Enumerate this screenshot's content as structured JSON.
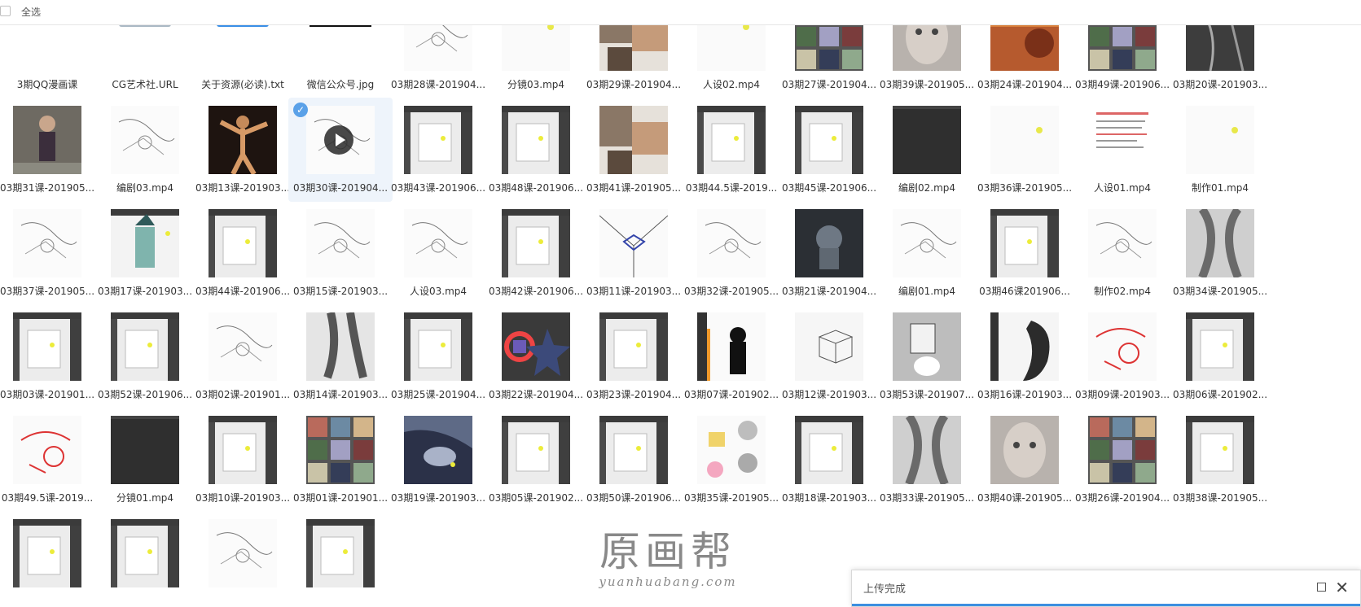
{
  "header": {
    "select_all": "全选"
  },
  "upload_panel": {
    "status": "上传完成"
  },
  "watermark": {
    "cn": "原画帮",
    "en": "yuanhuabang.com"
  },
  "colors": {
    "accent": "#3d8fe0",
    "selected_bg": "#eef4fb"
  },
  "files": [
    {
      "name": "3期QQ漫画课",
      "thumb": "folder-icon",
      "row": 0,
      "col": 0
    },
    {
      "name": "CG艺术社.URL",
      "thumb": "url-icon",
      "row": 0,
      "col": 1
    },
    {
      "name": "关于资源(必读).txt",
      "thumb": "txt-icon",
      "row": 0,
      "col": 2
    },
    {
      "name": "微信公众号.jpg",
      "thumb": "qr",
      "row": 0,
      "col": 3
    },
    {
      "name": "03期28课-201904...",
      "thumb": "sketch",
      "row": 0,
      "col": 4
    },
    {
      "name": "分镜03.mp4",
      "thumb": "white",
      "row": 0,
      "col": 5
    },
    {
      "name": "03期29课-201904...",
      "thumb": "photo",
      "row": 0,
      "col": 6
    },
    {
      "name": "人设02.mp4",
      "thumb": "white",
      "row": 0,
      "col": 7
    },
    {
      "name": "03期27课-201904...",
      "thumb": "collage",
      "row": 0,
      "col": 8
    },
    {
      "name": "03期39课-201905...",
      "thumb": "face",
      "row": 0,
      "col": 9
    },
    {
      "name": "03期24课-201904...",
      "thumb": "warm",
      "row": 0,
      "col": 10
    },
    {
      "name": "03期49课-201906...",
      "thumb": "collage",
      "row": 0,
      "col": 11
    },
    {
      "name": "03期20课-201903...",
      "thumb": "dark",
      "row": 0,
      "col": 12
    },
    {
      "name": "03期31课-201905...",
      "thumb": "figure",
      "row": 1,
      "col": 0
    },
    {
      "name": "编剧03.mp4",
      "thumb": "sketch",
      "row": 1,
      "col": 1
    },
    {
      "name": "03期13课-201903...",
      "thumb": "dancer",
      "row": 1,
      "col": 2
    },
    {
      "name": "03期30课-201904...",
      "thumb": "sketch",
      "row": 1,
      "col": 3,
      "selected": true,
      "video": true
    },
    {
      "name": "03期43课-201906...",
      "thumb": "ps",
      "row": 1,
      "col": 4
    },
    {
      "name": "03期48课-201906...",
      "thumb": "ps",
      "row": 1,
      "col": 5
    },
    {
      "name": "03期41课-201905...",
      "thumb": "photo",
      "row": 1,
      "col": 6
    },
    {
      "name": "03期44.5课-2019...",
      "thumb": "ps",
      "row": 1,
      "col": 7
    },
    {
      "name": "03期45课-201906...",
      "thumb": "ps",
      "row": 1,
      "col": 8
    },
    {
      "name": "编剧02.mp4",
      "thumb": "darkgray",
      "row": 1,
      "col": 9
    },
    {
      "name": "03期36课-201905...",
      "thumb": "white",
      "row": 1,
      "col": 10
    },
    {
      "name": "人设01.mp4",
      "thumb": "doc",
      "row": 1,
      "col": 11
    },
    {
      "name": "制作01.mp4",
      "thumb": "white",
      "row": 1,
      "col": 12
    },
    {
      "name": "03期37课-201905...",
      "thumb": "sketch",
      "row": 2,
      "col": 0
    },
    {
      "name": "03期17课-201903...",
      "thumb": "witch",
      "row": 2,
      "col": 1
    },
    {
      "name": "03期44课-201906...",
      "thumb": "ps",
      "row": 2,
      "col": 2
    },
    {
      "name": "03期15课-201903...",
      "thumb": "sketch",
      "row": 2,
      "col": 3
    },
    {
      "name": "人设03.mp4",
      "thumb": "sketch",
      "row": 2,
      "col": 4
    },
    {
      "name": "03期42课-201906...",
      "thumb": "ps",
      "row": 2,
      "col": 5
    },
    {
      "name": "03期11课-201903...",
      "thumb": "perspective",
      "row": 2,
      "col": 6
    },
    {
      "name": "03期32课-201905...",
      "thumb": "sketch",
      "row": 2,
      "col": 7
    },
    {
      "name": "03期21课-201904...",
      "thumb": "creature",
      "row": 2,
      "col": 8
    },
    {
      "name": "编剧01.mp4",
      "thumb": "sketch",
      "row": 2,
      "col": 9
    },
    {
      "name": "03期46课201906...",
      "thumb": "ps",
      "row": 2,
      "col": 10
    },
    {
      "name": "制作02.mp4",
      "thumb": "sketch",
      "row": 2,
      "col": 11
    },
    {
      "name": "03期34课-201905...",
      "thumb": "torso",
      "row": 2,
      "col": 12
    },
    {
      "name": "03期03课-201901...",
      "thumb": "ps",
      "row": 3,
      "col": 0
    },
    {
      "name": "03期52课-201906...",
      "thumb": "ps",
      "row": 3,
      "col": 1
    },
    {
      "name": "03期02课-201901...",
      "thumb": "sketch",
      "row": 3,
      "col": 2
    },
    {
      "name": "03期14课-201903...",
      "thumb": "legs",
      "row": 3,
      "col": 3
    },
    {
      "name": "03期25课-201904...",
      "thumb": "ps",
      "row": 3,
      "col": 4
    },
    {
      "name": "03期22课-201904...",
      "thumb": "colorwheel",
      "row": 3,
      "col": 5
    },
    {
      "name": "03期23课-201904...",
      "thumb": "ps",
      "row": 3,
      "col": 6
    },
    {
      "name": "03期07课-201902...",
      "thumb": "silhouette",
      "row": 3,
      "col": 7
    },
    {
      "name": "03期12课-201903...",
      "thumb": "cube",
      "row": 3,
      "col": 8
    },
    {
      "name": "03期53课-201907...",
      "thumb": "gray",
      "row": 3,
      "col": 9
    },
    {
      "name": "03期16课-201903...",
      "thumb": "hair",
      "row": 3,
      "col": 10
    },
    {
      "name": "03期09课-201903...",
      "thumb": "redsketch",
      "row": 3,
      "col": 11
    },
    {
      "name": "03期06课-201902...",
      "thumb": "ps",
      "row": 3,
      "col": 12
    },
    {
      "name": "03期49.5课-2019...",
      "thumb": "redsketch",
      "row": 4,
      "col": 0
    },
    {
      "name": "分镜01.mp4",
      "thumb": "darkgray",
      "row": 4,
      "col": 1
    },
    {
      "name": "03期10课-201903...",
      "thumb": "ps",
      "row": 4,
      "col": 2
    },
    {
      "name": "03期01课-201901...",
      "thumb": "collage",
      "row": 4,
      "col": 3
    },
    {
      "name": "03期19课-201903...",
      "thumb": "armor",
      "row": 4,
      "col": 4
    },
    {
      "name": "03期05课-201902...",
      "thumb": "ps",
      "row": 4,
      "col": 5
    },
    {
      "name": "03期50课-201906...",
      "thumb": "ps",
      "row": 4,
      "col": 6
    },
    {
      "name": "03期35课-201905...",
      "thumb": "skulls",
      "row": 4,
      "col": 7
    },
    {
      "name": "03期18课-201903...",
      "thumb": "ps",
      "row": 4,
      "col": 8
    },
    {
      "name": "03期33课-201905...",
      "thumb": "torso",
      "row": 4,
      "col": 9
    },
    {
      "name": "03期40课-201905...",
      "thumb": "face",
      "row": 4,
      "col": 10
    },
    {
      "name": "03期26课-201904...",
      "thumb": "collage",
      "row": 4,
      "col": 11
    },
    {
      "name": "03期38课-201905...",
      "thumb": "ps",
      "row": 4,
      "col": 12
    },
    {
      "name": "",
      "thumb": "ps",
      "row": 5,
      "col": 0
    },
    {
      "name": "",
      "thumb": "ps",
      "row": 5,
      "col": 1
    },
    {
      "name": "",
      "thumb": "sketch",
      "row": 5,
      "col": 2
    },
    {
      "name": "",
      "thumb": "ps",
      "row": 5,
      "col": 3
    }
  ]
}
